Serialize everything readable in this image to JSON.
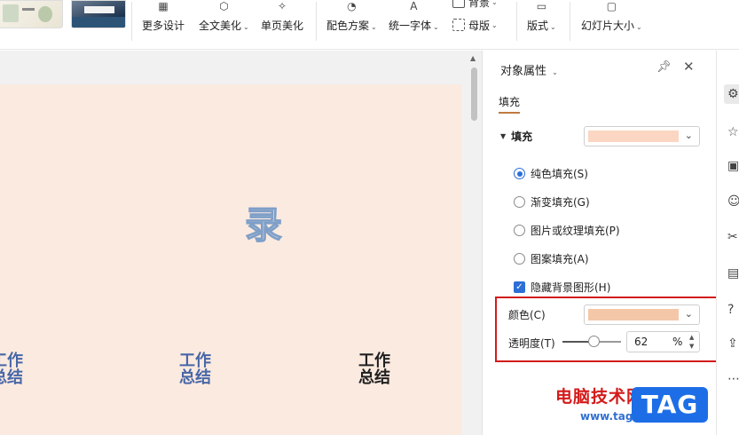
{
  "ribbon": {
    "buttons": [
      {
        "label": "更多设计",
        "icon": "design-icon"
      },
      {
        "label": "全文美化",
        "icon": "beautify-icon"
      },
      {
        "label": "单页美化",
        "icon": "page-beautify-icon"
      },
      {
        "label": "配色方案",
        "icon": "color-scheme-icon"
      },
      {
        "label": "统一字体",
        "icon": "font-icon"
      },
      {
        "label": "版式",
        "icon": "layout-icon"
      },
      {
        "label": "幻灯片大小",
        "icon": "slide-size-icon"
      }
    ],
    "small_buttons": [
      {
        "label": "背景",
        "icon": "background-icon"
      },
      {
        "label": "母版",
        "icon": "master-icon"
      }
    ]
  },
  "slide": {
    "big_char": "录",
    "items": [
      {
        "line1": "工作",
        "line2": "总结"
      },
      {
        "line1": "工作",
        "line2": "总结"
      },
      {
        "line1": "工作",
        "line2": "总结"
      }
    ]
  },
  "panel": {
    "title": "对象属性",
    "tab": "填充",
    "section_title": "填充",
    "fill_options": [
      {
        "label": "纯色填充(S)",
        "selected": true
      },
      {
        "label": "渐变填充(G)",
        "selected": false
      },
      {
        "label": "图片或纹理填充(P)",
        "selected": false
      },
      {
        "label": "图案填充(A)",
        "selected": false
      }
    ],
    "hide_bg_label": "隐藏背景图形(H)",
    "color_label": "颜色(C)",
    "color_swatch": "#f4c7a8",
    "fill_swatch": "#fbd6c2",
    "opacity_label": "透明度(T)",
    "opacity_value": "62",
    "opacity_unit": "%"
  },
  "watermark": {
    "text": "电脑技术网",
    "url": "www.tagxp.com",
    "tag": "TAG"
  }
}
